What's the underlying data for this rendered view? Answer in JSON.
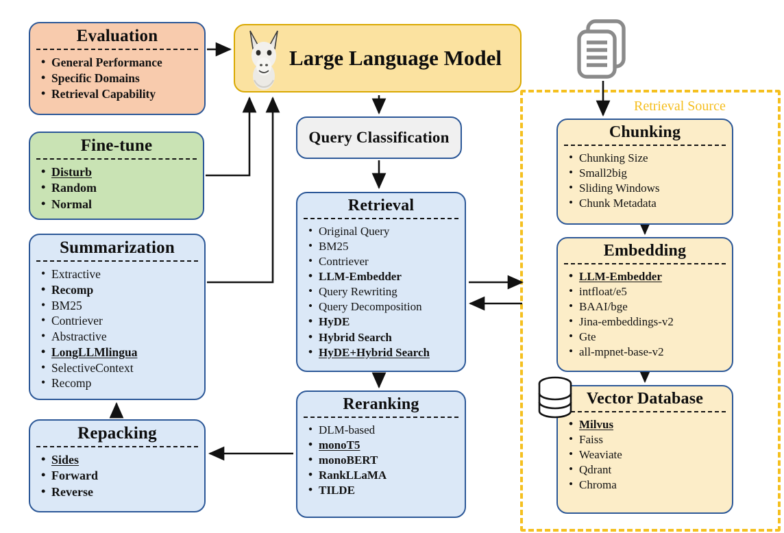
{
  "diagram": {
    "title": "RAG pipeline workflow diagram",
    "retrieval_source_label": "Retrieval Source",
    "colors": {
      "evaluation": "#f8cbad",
      "finetune": "#c9e3b4",
      "blue_box": "#dbe8f7",
      "llm_box": "#fbe2a0",
      "source_box": "#fcedc8",
      "query_class_box": "#f0f0f0",
      "border": "#2b5797",
      "llm_border": "#d9a800",
      "dashed_region": "#f5c01f",
      "highlight_blue": "#2d5c9e"
    }
  },
  "boxes": {
    "evaluation": {
      "title": "Evaluation",
      "items": [
        {
          "text": "General Performance",
          "style": "bold"
        },
        {
          "text": "Specific Domains",
          "style": "bold"
        },
        {
          "text": "Retrieval Capability",
          "style": "bold"
        }
      ]
    },
    "finetune": {
      "title": "Fine-tune",
      "items": [
        {
          "text": "Disturb",
          "style": "blue-underline"
        },
        {
          "text": "Random",
          "style": "bold"
        },
        {
          "text": "Normal",
          "style": "bold"
        }
      ]
    },
    "summarization": {
      "title": "Summarization",
      "items": [
        {
          "text": "Extractive",
          "style": "normal"
        },
        {
          "text": "Recomp",
          "style": "blue",
          "level": "sub"
        },
        {
          "text": "BM25",
          "style": "normal",
          "level": "sub"
        },
        {
          "text": "Contriever",
          "style": "normal",
          "level": "sub"
        },
        {
          "text": "Abstractive",
          "style": "normal"
        },
        {
          "text": "LongLLMlingua",
          "style": "bold-underline",
          "level": "sub"
        },
        {
          "text": "SelectiveContext",
          "style": "normal",
          "level": "sub"
        },
        {
          "text": "Recomp",
          "style": "normal",
          "level": "sub"
        }
      ]
    },
    "repacking": {
      "title": "Repacking",
      "items": [
        {
          "text": "Sides",
          "style": "bold-underline"
        },
        {
          "text": "Forward",
          "style": "bold"
        },
        {
          "text": "Reverse",
          "style": "blue"
        }
      ]
    },
    "llm": {
      "title": "Large Language Model",
      "icon": "llama-icon"
    },
    "query_classification": {
      "title": "Query Classification"
    },
    "retrieval": {
      "title": "Retrieval",
      "items": [
        {
          "text": "Original Query",
          "style": "normal"
        },
        {
          "text": "BM25",
          "style": "normal",
          "level": "sub"
        },
        {
          "text": "Contriever",
          "style": "normal",
          "level": "sub"
        },
        {
          "text": "LLM-Embedder",
          "style": "bold",
          "level": "sub"
        },
        {
          "text": "Query Rewriting",
          "style": "normal"
        },
        {
          "text": "Query Decomposition",
          "style": "normal"
        },
        {
          "text": "HyDE",
          "style": "bold"
        },
        {
          "text": "Hybrid Search",
          "style": "bold"
        },
        {
          "text": "HyDE+Hybrid Search",
          "style": "blue-underline"
        }
      ]
    },
    "reranking": {
      "title": "Reranking",
      "items": [
        {
          "text": "DLM-based",
          "style": "normal"
        },
        {
          "text": "monoT5",
          "style": "blue-underline",
          "level": "sub"
        },
        {
          "text": "monoBERT",
          "style": "bold",
          "level": "sub"
        },
        {
          "text": "RankLLaMA",
          "style": "bold",
          "level": "sub"
        },
        {
          "text": "TILDE",
          "style": "bold"
        }
      ]
    },
    "chunking": {
      "title": "Chunking",
      "items": [
        {
          "text": "Chunking Size",
          "style": "normal"
        },
        {
          "text": "Small2big",
          "style": "normal"
        },
        {
          "text": "Sliding Windows",
          "style": "normal"
        },
        {
          "text": "Chunk Metadata",
          "style": "normal"
        }
      ]
    },
    "embedding": {
      "title": "Embedding",
      "items": [
        {
          "text": "LLM-Embedder",
          "style": "blue-underline"
        },
        {
          "text": "intfloat/e5",
          "style": "normal"
        },
        {
          "text": "BAAI/bge",
          "style": "normal"
        },
        {
          "text": "Jina-embeddings-v2",
          "style": "normal"
        },
        {
          "text": "Gte",
          "style": "normal"
        },
        {
          "text": "all-mpnet-base-v2",
          "style": "normal"
        }
      ]
    },
    "vector_database": {
      "title": "Vector Database",
      "icon": "database-cylinder-icon",
      "items": [
        {
          "text": "Milvus",
          "style": "blue-underline"
        },
        {
          "text": "Faiss",
          "style": "normal"
        },
        {
          "text": "Weaviate",
          "style": "normal"
        },
        {
          "text": "Qdrant",
          "style": "normal"
        },
        {
          "text": "Chroma",
          "style": "normal"
        }
      ]
    },
    "documents": {
      "icon": "documents-stack-icon"
    }
  }
}
